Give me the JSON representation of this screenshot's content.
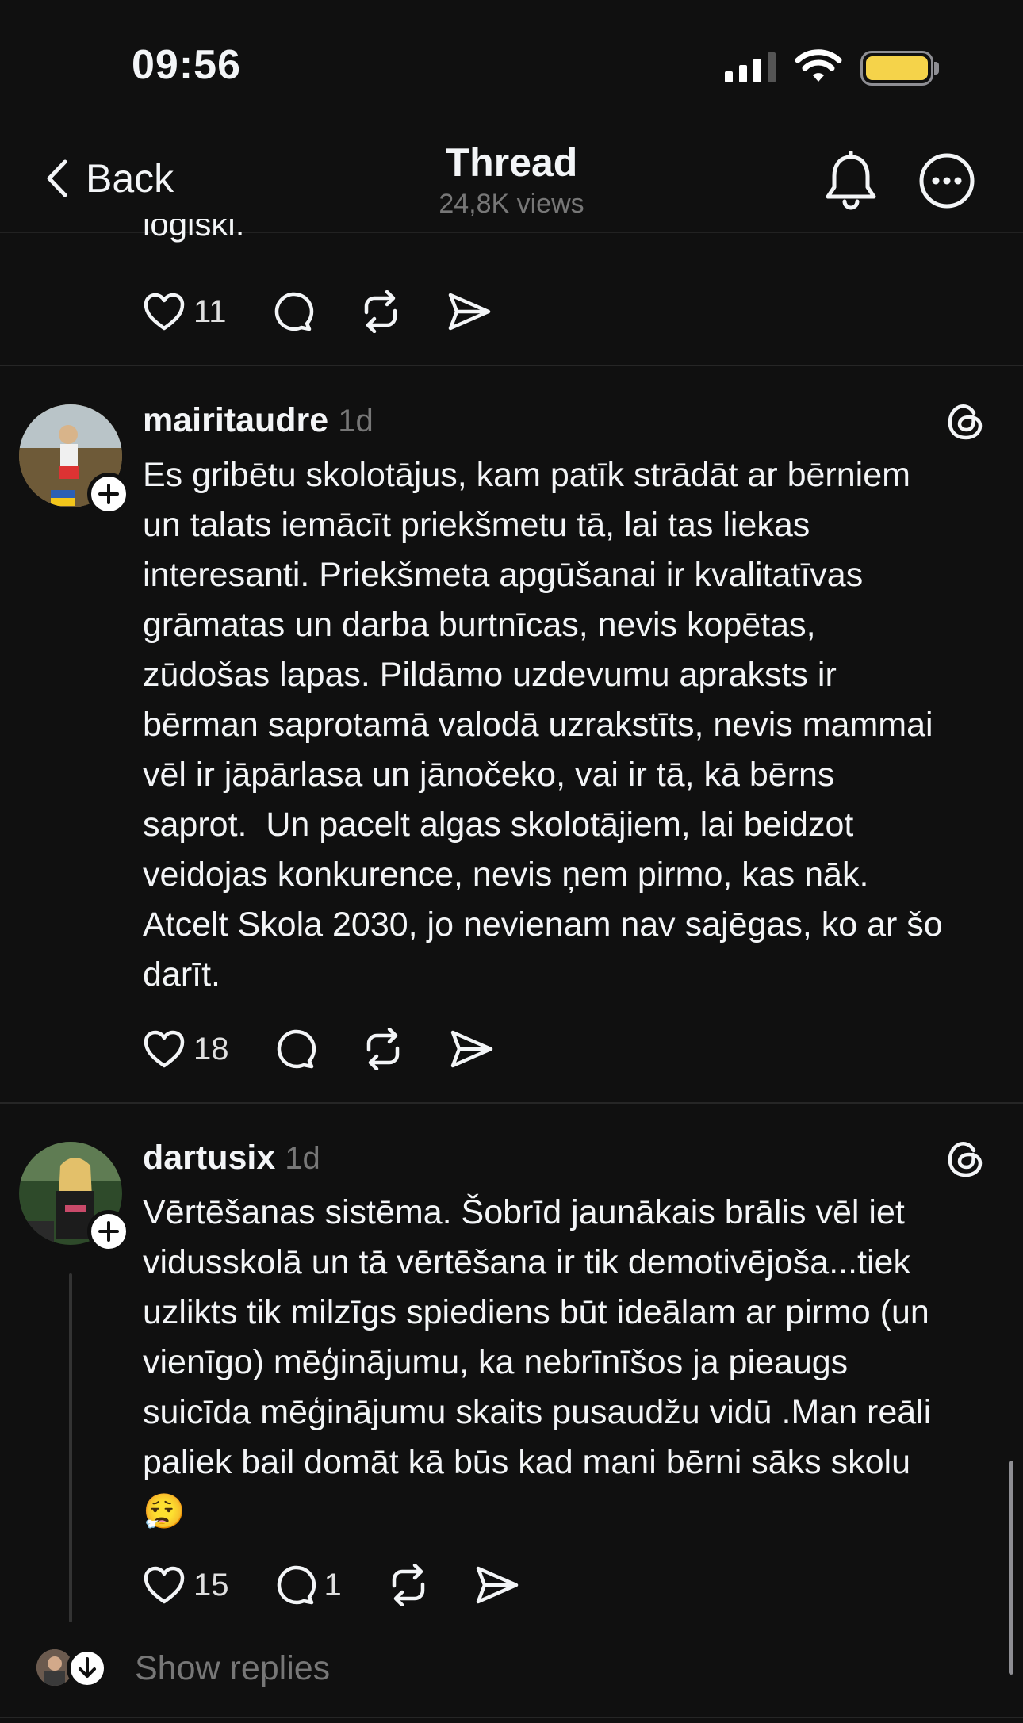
{
  "status": {
    "time": "09:56"
  },
  "nav": {
    "back_label": "Back",
    "title": "Thread",
    "subtitle": "24,8K views"
  },
  "prev_post": {
    "clipped_text": "loģiski.",
    "likes": "11"
  },
  "posts": [
    {
      "username": "mairitaudre",
      "time": "1d",
      "text": "Es gribētu skolotājus, kam patīk strādāt ar bērniem\nun talats iemācīt priekšmetu tā, lai tas liekas\ninteresanti. Priekšmeta apgūšanai ir kvalitatīvas\ngrāmatas un darba burtnīcas, nevis kopētas,\nzūdošas lapas. Pildāmo uzdevumu apraksts ir\nbērman saprotamā valodā uzrakstīts, nevis mammai\nvēl ir jāpārlasa un jānočeko, vai ir tā, kā bērns\nsaprot.  Un pacelt algas skolotājiem, lai beidzot\nveidojas konkurence, nevis ņem pirmo, kas nāk.\nAtcelt Skola 2030, jo nevienam nav sajēgas, ko ar šo\ndarīt.",
      "likes": "18",
      "replies": ""
    },
    {
      "username": "dartusix",
      "time": "1d",
      "text": "Vērtēšanas sistēma. Šobrīd jaunākais brālis vēl iet\nvidusskolā un tā vērtēšana ir tik demotivējoša...tiek\nuzlikts tik milzīgs spiediens būt ideālam ar pirmo (un\nvienīgo) mēģinājumu, ka nebrīnīšos ja pieaugs\nsuicīda mēģinājumu skaits pusaudžu vidū .Man reāli\npaliek bail domāt kā būs kad mani bērni sāks skolu\n😮‍💨",
      "likes": "15",
      "replies": "1"
    }
  ],
  "show_replies_label": "Show replies",
  "colors": {
    "background": "#101010",
    "text": "#f3f5f7",
    "muted": "#777777",
    "battery": "#f5d34a"
  }
}
